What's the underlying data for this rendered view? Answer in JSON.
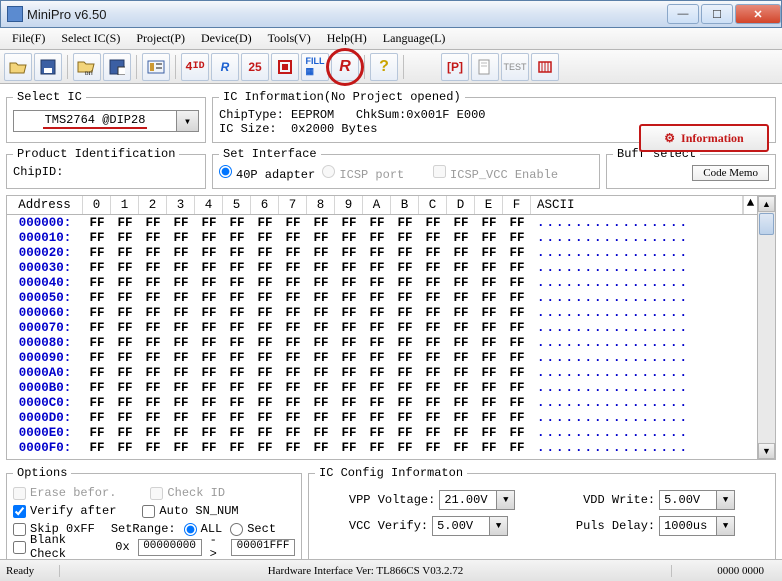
{
  "window": {
    "title": "MiniPro v6.50"
  },
  "menu": [
    "File(F)",
    "Select IC(S)",
    "Project(P)",
    "Device(D)",
    "Tools(V)",
    "Help(H)",
    "Language(L)"
  ],
  "toolbar_icons": [
    "open",
    "save",
    "project",
    "save-project",
    "id",
    "read4d",
    "reflash",
    "verify25",
    "erase",
    "fill",
    "run",
    "help",
    "param",
    "edit",
    "test",
    "multi"
  ],
  "select_ic": {
    "legend": "Select IC",
    "value": "TMS2764 @DIP28"
  },
  "ic_info": {
    "legend": "IC Information(No Project opened)",
    "chip_type_label": "ChipType:",
    "chip_type": "EEPROM",
    "chksum_label": "ChkSum:",
    "chksum": "0x001F E000",
    "ic_size_label": "IC Size:",
    "ic_size": "0x2000 Bytes",
    "info_btn": "Information"
  },
  "prod_id": {
    "legend": "Product Identification",
    "chipid_label": "ChipID:"
  },
  "set_if": {
    "legend": "Set Interface",
    "opt40p": "40P adapter",
    "opticsp": "ICSP port",
    "opticspvcc": "ICSP_VCC Enable"
  },
  "buff": {
    "legend": "Buff select",
    "codememo": "Code Memo"
  },
  "hex": {
    "addr_hdr": "Address",
    "cols": [
      "0",
      "1",
      "2",
      "3",
      "4",
      "5",
      "6",
      "7",
      "8",
      "9",
      "A",
      "B",
      "C",
      "D",
      "E",
      "F"
    ],
    "ascii_hdr": "ASCII",
    "rows": [
      {
        "addr": "000000:",
        "bytes": [
          "FF",
          "FF",
          "FF",
          "FF",
          "FF",
          "FF",
          "FF",
          "FF",
          "FF",
          "FF",
          "FF",
          "FF",
          "FF",
          "FF",
          "FF",
          "FF"
        ],
        "ascii": "................"
      },
      {
        "addr": "000010:",
        "bytes": [
          "FF",
          "FF",
          "FF",
          "FF",
          "FF",
          "FF",
          "FF",
          "FF",
          "FF",
          "FF",
          "FF",
          "FF",
          "FF",
          "FF",
          "FF",
          "FF"
        ],
        "ascii": "................"
      },
      {
        "addr": "000020:",
        "bytes": [
          "FF",
          "FF",
          "FF",
          "FF",
          "FF",
          "FF",
          "FF",
          "FF",
          "FF",
          "FF",
          "FF",
          "FF",
          "FF",
          "FF",
          "FF",
          "FF"
        ],
        "ascii": "................"
      },
      {
        "addr": "000030:",
        "bytes": [
          "FF",
          "FF",
          "FF",
          "FF",
          "FF",
          "FF",
          "FF",
          "FF",
          "FF",
          "FF",
          "FF",
          "FF",
          "FF",
          "FF",
          "FF",
          "FF"
        ],
        "ascii": "................"
      },
      {
        "addr": "000040:",
        "bytes": [
          "FF",
          "FF",
          "FF",
          "FF",
          "FF",
          "FF",
          "FF",
          "FF",
          "FF",
          "FF",
          "FF",
          "FF",
          "FF",
          "FF",
          "FF",
          "FF"
        ],
        "ascii": "................"
      },
      {
        "addr": "000050:",
        "bytes": [
          "FF",
          "FF",
          "FF",
          "FF",
          "FF",
          "FF",
          "FF",
          "FF",
          "FF",
          "FF",
          "FF",
          "FF",
          "FF",
          "FF",
          "FF",
          "FF"
        ],
        "ascii": "................"
      },
      {
        "addr": "000060:",
        "bytes": [
          "FF",
          "FF",
          "FF",
          "FF",
          "FF",
          "FF",
          "FF",
          "FF",
          "FF",
          "FF",
          "FF",
          "FF",
          "FF",
          "FF",
          "FF",
          "FF"
        ],
        "ascii": "................"
      },
      {
        "addr": "000070:",
        "bytes": [
          "FF",
          "FF",
          "FF",
          "FF",
          "FF",
          "FF",
          "FF",
          "FF",
          "FF",
          "FF",
          "FF",
          "FF",
          "FF",
          "FF",
          "FF",
          "FF"
        ],
        "ascii": "................"
      },
      {
        "addr": "000080:",
        "bytes": [
          "FF",
          "FF",
          "FF",
          "FF",
          "FF",
          "FF",
          "FF",
          "FF",
          "FF",
          "FF",
          "FF",
          "FF",
          "FF",
          "FF",
          "FF",
          "FF"
        ],
        "ascii": "................"
      },
      {
        "addr": "000090:",
        "bytes": [
          "FF",
          "FF",
          "FF",
          "FF",
          "FF",
          "FF",
          "FF",
          "FF",
          "FF",
          "FF",
          "FF",
          "FF",
          "FF",
          "FF",
          "FF",
          "FF"
        ],
        "ascii": "................"
      },
      {
        "addr": "0000A0:",
        "bytes": [
          "FF",
          "FF",
          "FF",
          "FF",
          "FF",
          "FF",
          "FF",
          "FF",
          "FF",
          "FF",
          "FF",
          "FF",
          "FF",
          "FF",
          "FF",
          "FF"
        ],
        "ascii": "................"
      },
      {
        "addr": "0000B0:",
        "bytes": [
          "FF",
          "FF",
          "FF",
          "FF",
          "FF",
          "FF",
          "FF",
          "FF",
          "FF",
          "FF",
          "FF",
          "FF",
          "FF",
          "FF",
          "FF",
          "FF"
        ],
        "ascii": "................"
      },
      {
        "addr": "0000C0:",
        "bytes": [
          "FF",
          "FF",
          "FF",
          "FF",
          "FF",
          "FF",
          "FF",
          "FF",
          "FF",
          "FF",
          "FF",
          "FF",
          "FF",
          "FF",
          "FF",
          "FF"
        ],
        "ascii": "................"
      },
      {
        "addr": "0000D0:",
        "bytes": [
          "FF",
          "FF",
          "FF",
          "FF",
          "FF",
          "FF",
          "FF",
          "FF",
          "FF",
          "FF",
          "FF",
          "FF",
          "FF",
          "FF",
          "FF",
          "FF"
        ],
        "ascii": "................"
      },
      {
        "addr": "0000E0:",
        "bytes": [
          "FF",
          "FF",
          "FF",
          "FF",
          "FF",
          "FF",
          "FF",
          "FF",
          "FF",
          "FF",
          "FF",
          "FF",
          "FF",
          "FF",
          "FF",
          "FF"
        ],
        "ascii": "................"
      },
      {
        "addr": "0000F0:",
        "bytes": [
          "FF",
          "FF",
          "FF",
          "FF",
          "FF",
          "FF",
          "FF",
          "FF",
          "FF",
          "FF",
          "FF",
          "FF",
          "FF",
          "FF",
          "FF",
          "FF"
        ],
        "ascii": "................"
      }
    ]
  },
  "options": {
    "legend": "Options",
    "erase": "Erase befor.",
    "checkid": "Check ID",
    "verify": "Verify after",
    "autosn": "Auto SN_NUM",
    "skip": "Skip 0xFF",
    "setrange": "SetRange:",
    "all": "ALL",
    "sect": "Sect",
    "blank": "Blank Check",
    "ox": "0x",
    "from": "00000000",
    "arrow": "->",
    "to": "00001FFF"
  },
  "iccfg": {
    "legend": "IC Config Informaton",
    "vpp_label": "VPP Voltage:",
    "vpp": "21.00V",
    "vdd_label": "VDD Write:",
    "vdd": "5.00V",
    "vcc_label": "VCC Verify:",
    "vcc": "5.00V",
    "puls_label": "Puls Delay:",
    "puls": "1000us"
  },
  "status": {
    "ready": "Ready",
    "hw": "Hardware Interface Ver: TL866CS V03.2.72",
    "addr": "0000 0000"
  }
}
